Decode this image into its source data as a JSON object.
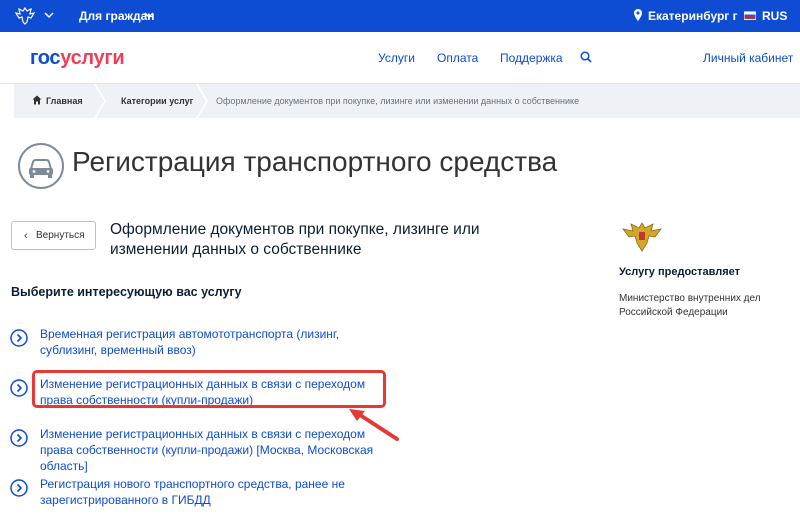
{
  "topbar": {
    "for_citizens": "Для граждан",
    "location": "Екатеринбург г",
    "language": "RUS"
  },
  "header": {
    "logo_part1": "гос",
    "logo_part2": "услуги",
    "nav": [
      "Услуги",
      "Оплата",
      "Поддержка"
    ],
    "cabinet": "Личный кабинет"
  },
  "breadcrumbs": {
    "home": "Главная",
    "category": "Категории услуг",
    "current": "Оформление документов при покупке, лизинге или изменении данных о собственнике"
  },
  "page": {
    "title": "Регистрация транспортного средства",
    "back_label": "Вернуться",
    "subtitle": "Оформление документов при покупке, лизинге или изменении данных о собственнике",
    "choose_label": "Выберите интересующую вас услугу"
  },
  "services": [
    "Временная регистрация автомототранспорта (лизинг, сублизинг, временный ввоз)",
    "Изменение регистрационных данных в связи с переходом права собственности (купли-продажи)",
    "Изменение регистрационных данных в связи с переходом права собственности (купли-продажи) [Москва, Московская область]",
    "Регистрация нового транспортного средства, ранее не зарегистрированного в ГИБДД"
  ],
  "provider": {
    "heading": "Услугу предоставляет",
    "name": "Министерство внутренних дел Российской Федерации"
  },
  "colors": {
    "brand_blue": "#0d4cd3",
    "brand_red": "#ee3f58",
    "highlight": "#e53935"
  }
}
